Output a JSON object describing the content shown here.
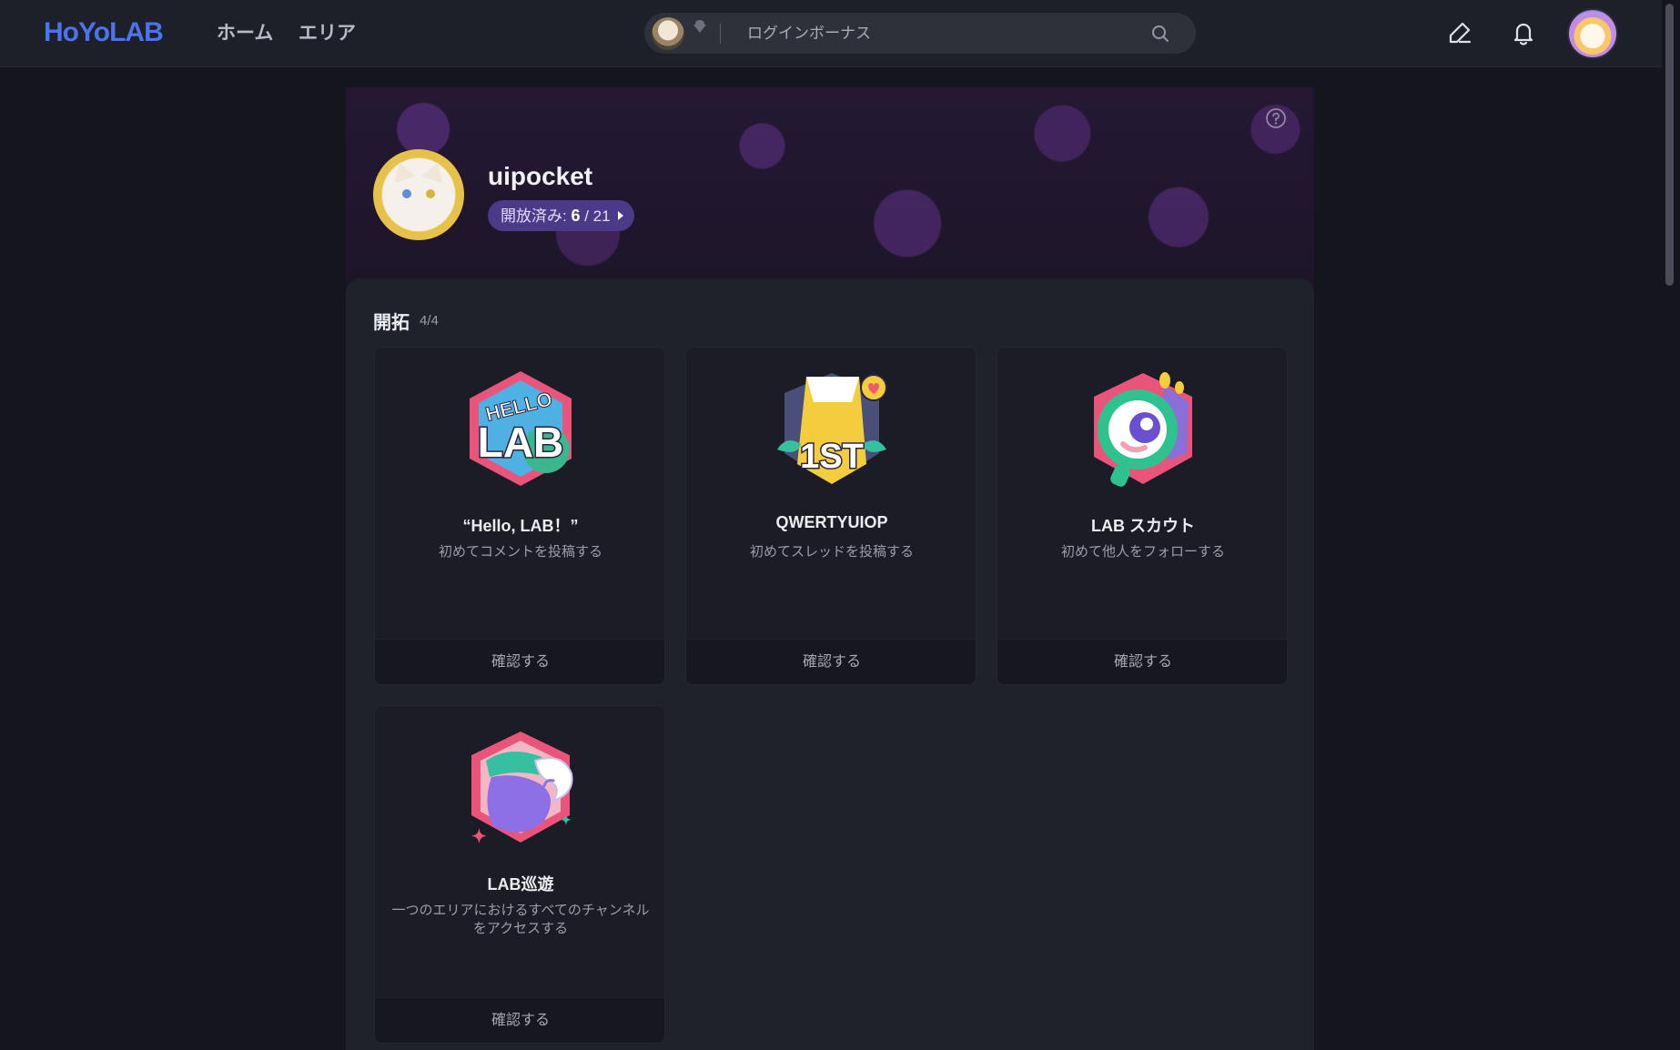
{
  "header": {
    "logo": "HoYoLAB",
    "nav": {
      "home": "ホーム",
      "area": "エリア"
    },
    "search": {
      "placeholder": "ログインボーナス"
    }
  },
  "profile": {
    "username": "uipocket",
    "unlocked_label": "開放済み: ",
    "unlocked_count": "6",
    "unlocked_total": " / 21"
  },
  "section": {
    "title": "開拓",
    "count": "4/4"
  },
  "achievements": [
    {
      "title": "“Hello, LAB！”",
      "desc": "初めてコメントを投稿する",
      "button": "確認する",
      "badge": "hello-lab-badge"
    },
    {
      "title": "QWERTYUIOP",
      "desc": "初めてスレッドを投稿する",
      "button": "確認する",
      "badge": "first-post-badge"
    },
    {
      "title": "LAB スカウト",
      "desc": "初めて他人をフォローする",
      "button": "確認する",
      "badge": "scout-badge"
    },
    {
      "title": "LAB巡遊",
      "desc": "一つのエリアにおけるすべてのチャンネルをアクセスする",
      "button": "確認する",
      "badge": "tour-badge"
    }
  ],
  "colors": {
    "background": "#14151d",
    "topbar": "#1d1f29",
    "accent": "#4c73e8",
    "pill": "#4a3a87",
    "panel": "#1f212b"
  }
}
